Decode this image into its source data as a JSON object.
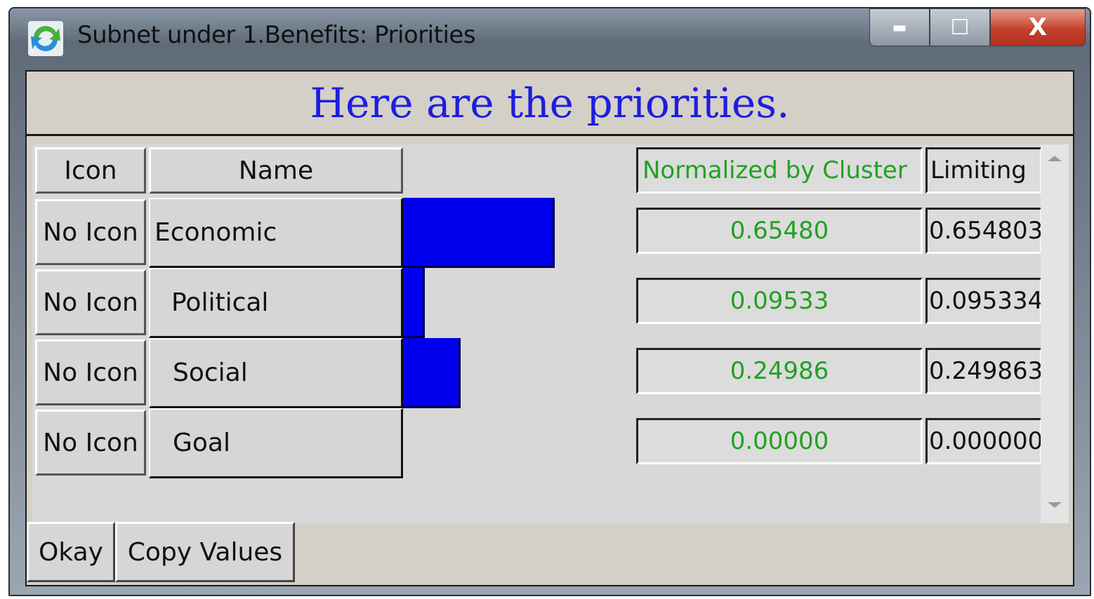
{
  "window": {
    "title": "Subnet under 1.Benefits: Priorities",
    "minimize_label": "▬",
    "maximize_label": "☐",
    "close_label": "X"
  },
  "header": {
    "text": "Here are the priorities."
  },
  "table": {
    "columns": {
      "icon": "Icon",
      "name": "Name",
      "normalized": "Normalized by Cluster",
      "limiting": "Limiting"
    },
    "rows": [
      {
        "icon": "No Icon",
        "name": "Economic",
        "normalized": "0.65480",
        "limiting": "0.654803",
        "value": 0.6548
      },
      {
        "icon": "No Icon",
        "name": "Political",
        "normalized": "0.09533",
        "limiting": "0.095334",
        "value": 0.09533
      },
      {
        "icon": "No Icon",
        "name": "Social",
        "normalized": "0.24986",
        "limiting": "0.249863",
        "value": 0.24986
      },
      {
        "icon": "No Icon",
        "name": "Goal",
        "normalized": "0.00000",
        "limiting": "0.000000",
        "value": 0.0
      }
    ]
  },
  "buttons": {
    "okay": "Okay",
    "copy_values": "Copy Values"
  },
  "colors": {
    "header_text": "#1d1de0",
    "bar": "#0000ee",
    "normalized_text": "#22a022"
  }
}
